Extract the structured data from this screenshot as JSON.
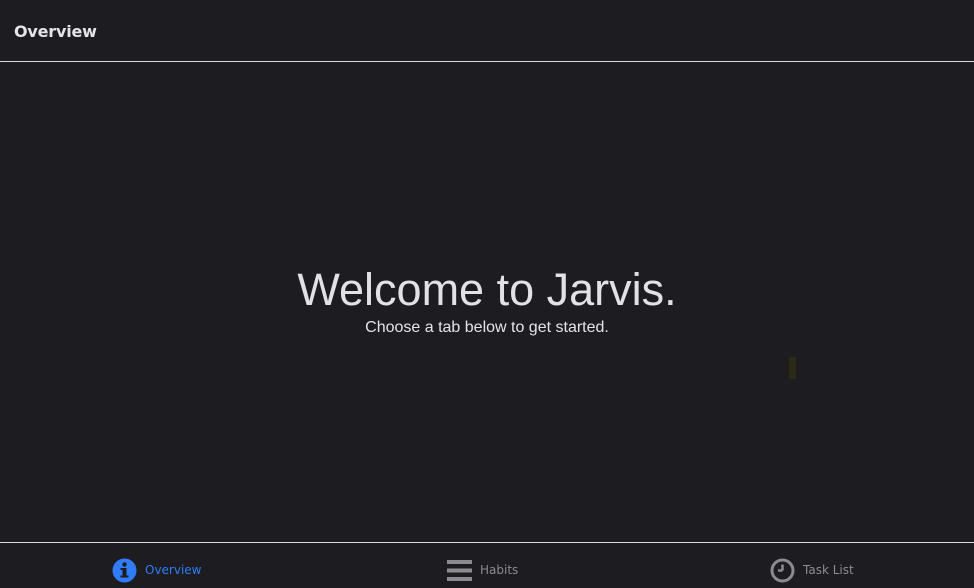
{
  "header": {
    "title": "Overview"
  },
  "main": {
    "heading": "Welcome to Jarvis.",
    "subheading": "Choose a tab below to get started."
  },
  "tabs": [
    {
      "label": "Overview",
      "icon": "info-circle-icon",
      "active": true
    },
    {
      "label": "Habits",
      "icon": "list-lines-icon",
      "active": false
    },
    {
      "label": "Task List",
      "icon": "clock-icon",
      "active": false
    }
  ],
  "colors": {
    "background": "#1c1c21",
    "accent": "#2f7cf6",
    "inactive": "#8b8b91",
    "text": "#e4e4e8"
  }
}
